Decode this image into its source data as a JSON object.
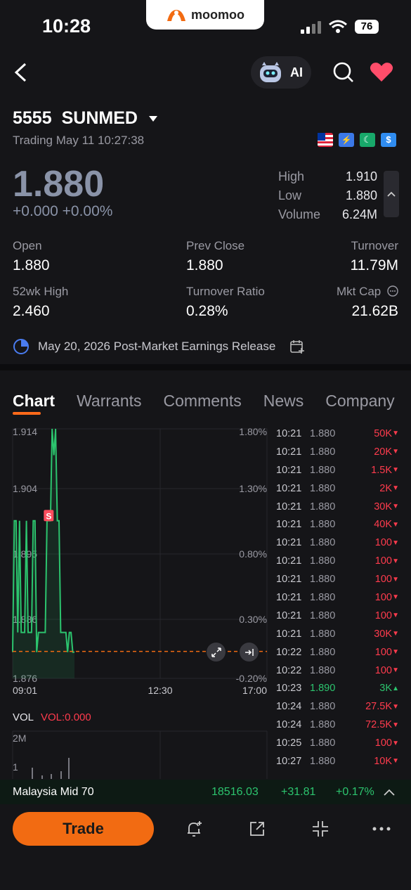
{
  "status": {
    "time": "10:28",
    "battery": "76"
  },
  "brand": {
    "name": "moomoo"
  },
  "header": {
    "ai_label": "AI"
  },
  "stock": {
    "code": "5555",
    "name": "SUNMED",
    "trading_info": "Trading May 11 10:27:38",
    "price": "1.880",
    "change": "+0.000 +0.00%",
    "high_label": "High",
    "high": "1.910",
    "low_label": "Low",
    "low": "1.880",
    "volume_label": "Volume",
    "volume": "6.24M"
  },
  "stats": [
    {
      "label": "Open",
      "value": "1.880"
    },
    {
      "label": "Prev Close",
      "value": "1.880"
    },
    {
      "label": "Turnover",
      "value": "11.79M"
    },
    {
      "label": "52wk High",
      "value": "2.460"
    },
    {
      "label": "Turnover Ratio",
      "value": "0.28%"
    },
    {
      "label": "Mkt Cap",
      "value": "21.62B"
    }
  ],
  "earnings": {
    "text": "May 20, 2026 Post-Market Earnings Release"
  },
  "tabs": [
    "Chart",
    "Warrants",
    "Comments",
    "News",
    "Company"
  ],
  "chart_data": {
    "type": "line",
    "y_left_ticks": [
      "1.914",
      "1.904",
      "1.895",
      "1.886",
      "1.876"
    ],
    "y_right_ticks": [
      "1.80%",
      "1.30%",
      "0.80%",
      "0.30%",
      "-0.20%"
    ],
    "x_ticks": [
      "09:01",
      "12:30",
      "17:00"
    ],
    "ylim": [
      1.876,
      1.914
    ],
    "prev_close": 1.88,
    "marker_label": "S",
    "series": [
      {
        "values": [
          1.88,
          1.9,
          1.9,
          1.883,
          1.9,
          1.883,
          1.883,
          1.883,
          1.9,
          1.883,
          1.883,
          1.883,
          1.9,
          1.9,
          1.88,
          1.883,
          1.883,
          1.883,
          1.883,
          1.883,
          1.9,
          1.9,
          1.9,
          1.914,
          1.91,
          1.914,
          1.9,
          1.9,
          1.883,
          1.883,
          1.883,
          1.883,
          1.88,
          1.883,
          1.883,
          1.88,
          1.88
        ]
      }
    ],
    "vol_label": "VOL",
    "vol_value": "VOL:0.000",
    "vol_ticks": [
      "2M",
      "1"
    ]
  },
  "ticks": [
    {
      "time": "10:21",
      "price": "1.880",
      "vol": "50K",
      "dir": "down"
    },
    {
      "time": "10:21",
      "price": "1.880",
      "vol": "20K",
      "dir": "down"
    },
    {
      "time": "10:21",
      "price": "1.880",
      "vol": "1.5K",
      "dir": "down"
    },
    {
      "time": "10:21",
      "price": "1.880",
      "vol": "2K",
      "dir": "down"
    },
    {
      "time": "10:21",
      "price": "1.880",
      "vol": "30K",
      "dir": "down"
    },
    {
      "time": "10:21",
      "price": "1.880",
      "vol": "40K",
      "dir": "down"
    },
    {
      "time": "10:21",
      "price": "1.880",
      "vol": "100",
      "dir": "down"
    },
    {
      "time": "10:21",
      "price": "1.880",
      "vol": "100",
      "dir": "down"
    },
    {
      "time": "10:21",
      "price": "1.880",
      "vol": "100",
      "dir": "down"
    },
    {
      "time": "10:21",
      "price": "1.880",
      "vol": "100",
      "dir": "down"
    },
    {
      "time": "10:21",
      "price": "1.880",
      "vol": "100",
      "dir": "down"
    },
    {
      "time": "10:21",
      "price": "1.880",
      "vol": "30K",
      "dir": "down"
    },
    {
      "time": "10:22",
      "price": "1.880",
      "vol": "100",
      "dir": "down"
    },
    {
      "time": "10:22",
      "price": "1.880",
      "vol": "100",
      "dir": "down"
    },
    {
      "time": "10:23",
      "price": "1.890",
      "vol": "3K",
      "dir": "up"
    },
    {
      "time": "10:24",
      "price": "1.880",
      "vol": "27.5K",
      "dir": "down"
    },
    {
      "time": "10:24",
      "price": "1.880",
      "vol": "72.5K",
      "dir": "down"
    },
    {
      "time": "10:25",
      "price": "1.880",
      "vol": "100",
      "dir": "down"
    },
    {
      "time": "10:27",
      "price": "1.880",
      "vol": "10K",
      "dir": "down"
    }
  ],
  "index": {
    "name": "Malaysia Mid 70",
    "value": "18516.03",
    "change": "+31.81",
    "pct": "+0.17%"
  },
  "bottom": {
    "trade_label": "Trade"
  },
  "colors": {
    "up": "#2cc46e",
    "down": "#ff3b4d",
    "accent": "#f26b12",
    "line": "#2cc46e"
  }
}
